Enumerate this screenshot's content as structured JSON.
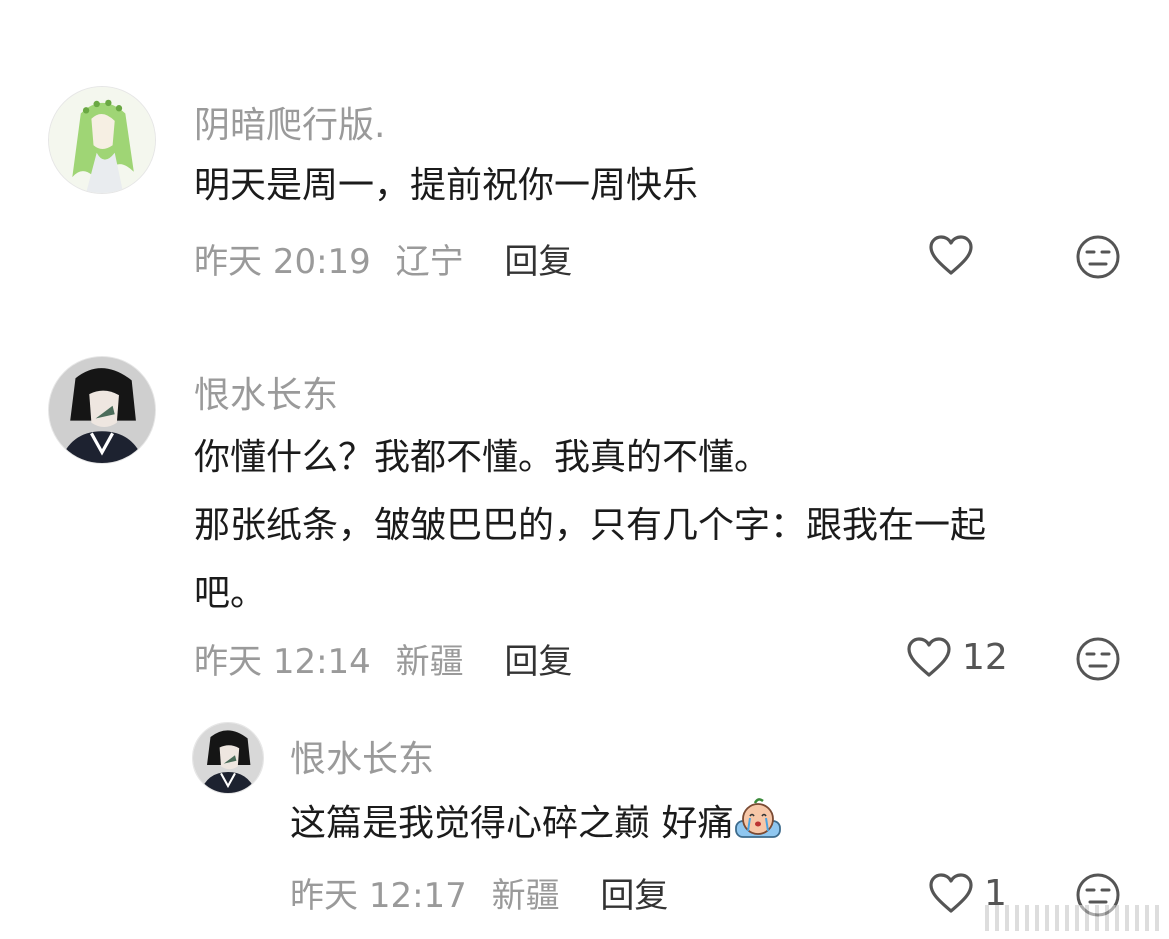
{
  "comments": [
    {
      "username": "阴暗爬行版.",
      "lines": [
        "明天是周一，提前祝你一周快乐"
      ],
      "date": "昨天",
      "time": "20:19",
      "location": "辽宁",
      "reply_label": "回复",
      "like_count": ""
    },
    {
      "username": "恨水长东",
      "lines": [
        "你懂什么？我都不懂。我真的不懂。",
        "那张纸条，皱皱巴巴的，只有几个字：跟我在一起",
        "吧。"
      ],
      "date": "昨天",
      "time": "12:14",
      "location": "新疆",
      "reply_label": "回复",
      "like_count": "12"
    },
    {
      "username": "恨水长东",
      "lines": [
        "这篇是我觉得心碎之巅 好痛"
      ],
      "emoji": "crying-emoji",
      "date": "昨天",
      "time": "12:17",
      "location": "新疆",
      "reply_label": "回复",
      "like_count": "1"
    }
  ],
  "icons": {
    "like": "heart-outline-icon",
    "dislike": "neutral-face-icon"
  },
  "colors": {
    "username": "#9a9a9a",
    "text": "#1b1b1b",
    "meta": "#9a9a9a",
    "reply": "#333333",
    "icon": "#555555"
  }
}
